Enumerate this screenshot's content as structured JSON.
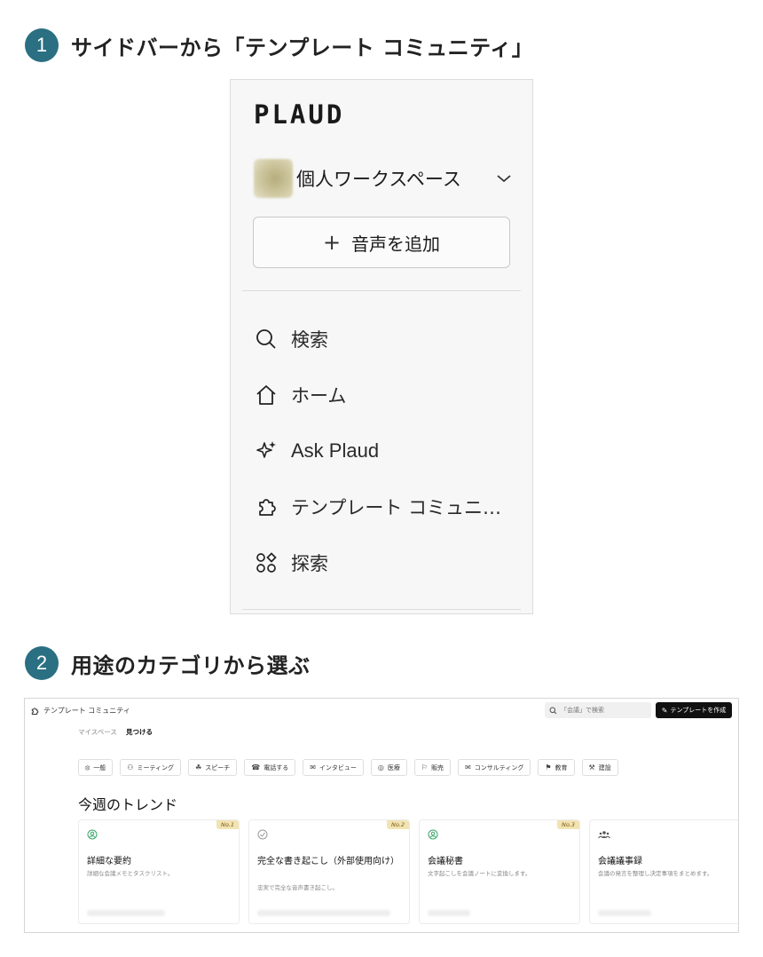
{
  "steps": [
    {
      "number": "1",
      "title": "サイドバーから「テンプレート コミュニティ」"
    },
    {
      "number": "2",
      "title": "用途のカテゴリから選ぶ"
    }
  ],
  "sidebar": {
    "logo": "PLAUD",
    "workspace": {
      "label": "個人ワークスペース"
    },
    "add_button": {
      "plus": "+",
      "label": "音声を追加"
    },
    "items": [
      {
        "label": "検索",
        "icon": "search-icon"
      },
      {
        "label": "ホーム",
        "icon": "home-icon"
      },
      {
        "label": "Ask Plaud",
        "icon": "sparkle-icon"
      },
      {
        "label": "テンプレート コミュニ…",
        "icon": "puzzle-icon"
      },
      {
        "label": "探索",
        "icon": "grid-icon"
      }
    ]
  },
  "screenshot": {
    "title": "テンプレート コミュニティ",
    "search_placeholder": "「会議」で検索",
    "create_button": "テンプレートを作成",
    "tabs": [
      {
        "label": "マイスペース",
        "active": false
      },
      {
        "label": "見つける",
        "active": true
      }
    ],
    "categories": [
      {
        "icon": "⦻",
        "label": "一般"
      },
      {
        "icon": "⚇",
        "label": "ミーティング"
      },
      {
        "icon": "☘",
        "label": "スピーチ"
      },
      {
        "icon": "☎",
        "label": "電話する"
      },
      {
        "icon": "✉",
        "label": "インタビュー"
      },
      {
        "icon": "◎",
        "label": "医療"
      },
      {
        "icon": "⚐",
        "label": "販売"
      },
      {
        "icon": "✉",
        "label": "コンサルティング"
      },
      {
        "icon": "⚑",
        "label": "教育"
      },
      {
        "icon": "⚒",
        "label": "建設"
      }
    ],
    "trend_title": "今週のトレンド",
    "cards": [
      {
        "rank": "No.1",
        "name": "詳細な要約",
        "desc": "詳細な会議メモとタスクリスト。",
        "icon": "user-circle-icon",
        "icon_color": "#3aa66a"
      },
      {
        "rank": "No.2",
        "name": "完全な書き起こし（外部使用向け）",
        "desc": "忠実で完全な音声書き起こし。",
        "icon": "check-circle-icon",
        "icon_color": "#999999"
      },
      {
        "rank": "No.3",
        "name": "会議秘書",
        "desc": "文字起こしを会議ノートに変換します。",
        "icon": "user-circle-icon",
        "icon_color": "#3aa66a"
      },
      {
        "rank": "",
        "name": "会議議事録",
        "desc": "会議の発言を整理し決定事項をまとめます。",
        "icon": "people-icon",
        "icon_color": "#555555"
      }
    ]
  }
}
